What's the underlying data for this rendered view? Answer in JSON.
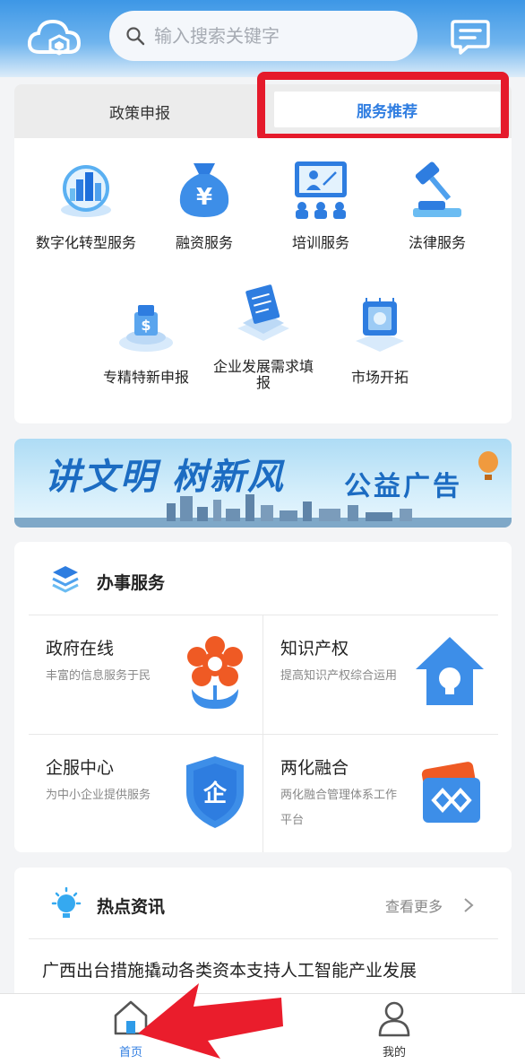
{
  "header": {
    "search_placeholder": "输入搜索关键字"
  },
  "tabs": [
    {
      "label": "政策申报"
    },
    {
      "label": "服务推荐"
    }
  ],
  "services": [
    {
      "label": "数字化转型服务",
      "icon": "city-icon"
    },
    {
      "label": "融资服务",
      "icon": "money-bag-icon"
    },
    {
      "label": "培训服务",
      "icon": "training-icon"
    },
    {
      "label": "法律服务",
      "icon": "gavel-icon"
    },
    {
      "label": "专精特新申报",
      "icon": "dollar-platform-icon"
    },
    {
      "label": "企业发展需求填报",
      "icon": "document-form-icon"
    },
    {
      "label": "市场开拓",
      "icon": "market-chip-icon"
    }
  ],
  "banner": {
    "slogan": "讲文明 树新风",
    "tag": "公益广告"
  },
  "office": {
    "title": "办事服务",
    "cells": [
      {
        "title": "政府在线",
        "desc": "丰富的信息服务于民"
      },
      {
        "title": "知识产权",
        "desc": "提高知识产权综合运用"
      },
      {
        "title": "企服中心",
        "desc": "为中小企业提供服务"
      },
      {
        "title": "两化融合",
        "desc": "两化融合管理体系工作平台"
      }
    ]
  },
  "news": {
    "title": "热点资讯",
    "more": "查看更多",
    "items": [
      "广西出台措施撬动各类资本支持人工智能产业发展"
    ]
  },
  "bottom_nav": [
    {
      "label": "首页",
      "active": true
    },
    {
      "label": "我的",
      "active": false
    }
  ],
  "colors": {
    "accent": "#2f7de1",
    "highlight_red": "#e51a2b"
  }
}
